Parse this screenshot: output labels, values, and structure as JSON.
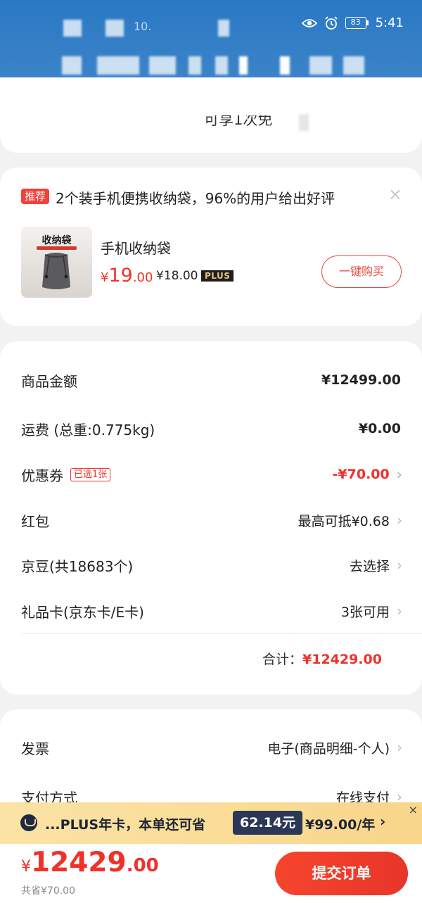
{
  "status_bar": {
    "time": "5:41",
    "battery": "83",
    "obscured_text": "10."
  },
  "top_card": {
    "partial_text": "可享1次免"
  },
  "recommend": {
    "badge": "推荐",
    "title": "2个装手机便携收纳袋，96%的用户给出好评",
    "close": "×",
    "product_image_text": "收纳袋",
    "product_name": "手机收纳袋",
    "price_symbol": "¥",
    "price_int": "19",
    "price_dec": ".00",
    "plus_price": "¥18.00",
    "plus_tag": "PLUS",
    "buy_button": "一键购买"
  },
  "summary": {
    "rows": [
      {
        "label": "商品金额",
        "value": "¥12499.00"
      },
      {
        "label": "运费 (总重:0.775kg)",
        "value": "¥0.00"
      },
      {
        "label": "优惠券",
        "tag": "已选1张",
        "value": "-¥70.00"
      },
      {
        "label": "红包",
        "value": "最高可抵¥0.68"
      },
      {
        "label": "京豆(共18683个)",
        "value": "去选择"
      },
      {
        "label": "礼品卡(京东卡/E卡)",
        "value": "3张可用"
      }
    ],
    "total_label": "合计：",
    "total_value": "¥12429.00"
  },
  "invoice": {
    "rows": [
      {
        "label": "发票",
        "value": "电子(商品明细-个人)"
      },
      {
        "label": "支付方式",
        "value": "在线支付"
      }
    ]
  },
  "plus_bar": {
    "text": "...PLUS年卡，本单还可省",
    "save_amount": "62.14元",
    "price": "¥99.00/年",
    "chevron": "›",
    "close": "×"
  },
  "bottom": {
    "currency": "¥",
    "total_int": "12429",
    "total_dec": ".00",
    "saved": "共省¥70.00",
    "submit": "提交订单"
  },
  "chevron": "›",
  "colors": {
    "accent_red": "#f0312a",
    "header_blue": "#2a78c4",
    "plus_gold": "#f8d68a",
    "plus_navy": "#2a3756"
  }
}
